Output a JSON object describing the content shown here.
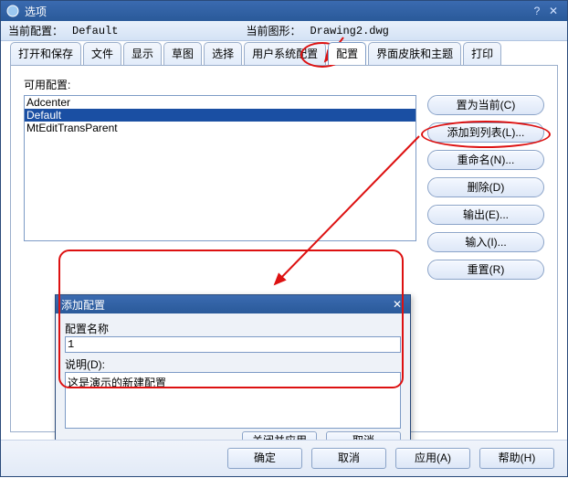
{
  "window": {
    "title": "选项"
  },
  "toprow": {
    "config_label": "当前配置：",
    "config_value": "Default",
    "drawing_label": "当前图形：",
    "drawing_value": "Drawing2.dwg"
  },
  "tabs": [
    {
      "label": "打开和保存"
    },
    {
      "label": "文件"
    },
    {
      "label": "显示"
    },
    {
      "label": "草图"
    },
    {
      "label": "选择"
    },
    {
      "label": "用户系统配置"
    },
    {
      "label": "配置"
    },
    {
      "label": "界面皮肤和主题"
    },
    {
      "label": "打印"
    }
  ],
  "active_tab_index": 6,
  "profiles": {
    "label": "可用配置:",
    "items": [
      "Adcenter",
      "Default",
      "MtEditTransParent"
    ],
    "selected_index": 1
  },
  "buttons": {
    "set_current": "置为当前(C)",
    "add": "添加到列表(L)...",
    "rename": "重命名(N)...",
    "delete": "删除(D)",
    "export": "输出(E)...",
    "import": "输入(I)...",
    "reset": "重置(R)"
  },
  "footer": {
    "ok": "确定",
    "cancel": "取消",
    "apply": "应用(A)",
    "help": "帮助(H)"
  },
  "modal": {
    "title": "添加配置",
    "name_label": "配置名称",
    "name_value": "1",
    "desc_label": "说明(D):",
    "desc_value": "这是演示的新建配置",
    "close_apply": "关闭并应用",
    "cancel": "取消"
  }
}
